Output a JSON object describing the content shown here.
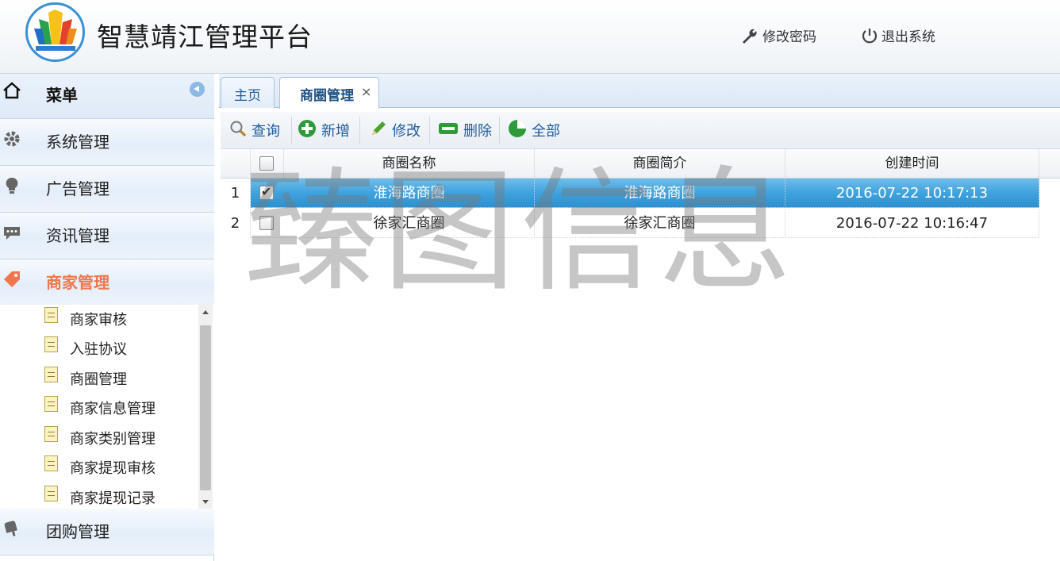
{
  "header": {
    "app_title": "智慧靖江管理平台",
    "change_password": "修改密码",
    "logout": "退出系统"
  },
  "sidebar": {
    "title": "菜单",
    "groups": [
      {
        "label": "系统管理",
        "icon": "gear-icon"
      },
      {
        "label": "广告管理",
        "icon": "lightbulb-icon"
      },
      {
        "label": "资讯管理",
        "icon": "chat-icon"
      },
      {
        "label": "商家管理",
        "icon": "tag-icon",
        "active": true
      },
      {
        "label": "团购管理",
        "icon": "popsicle-icon"
      }
    ],
    "sub_items": [
      "商家审核",
      "入驻协议",
      "商圈管理",
      "商家信息管理",
      "商家类别管理",
      "商家提现审核",
      "商家提现记录"
    ]
  },
  "tabs": [
    {
      "label": "主页"
    },
    {
      "label": "商圈管理",
      "close": "×",
      "active": true
    }
  ],
  "toolbar": {
    "query": "查询",
    "add": "新增",
    "edit": "修改",
    "delete": "删除",
    "all": "全部"
  },
  "grid": {
    "columns": [
      "商圈名称",
      "商圈简介",
      "创建时间"
    ],
    "rows": [
      {
        "num": "1",
        "name": "淮海路商圈",
        "intro": "淮海路商圈",
        "created": "2016-07-22 10:17:13",
        "checked": true
      },
      {
        "num": "2",
        "name": "徐家汇商圈",
        "intro": "徐家汇商圈",
        "created": "2016-07-22 10:16:47",
        "checked": false
      }
    ]
  },
  "watermark": "臻图信息",
  "colors": {
    "accent": "#3fa3de",
    "active_menu": "#f0764c",
    "tab_text": "#235d99"
  }
}
